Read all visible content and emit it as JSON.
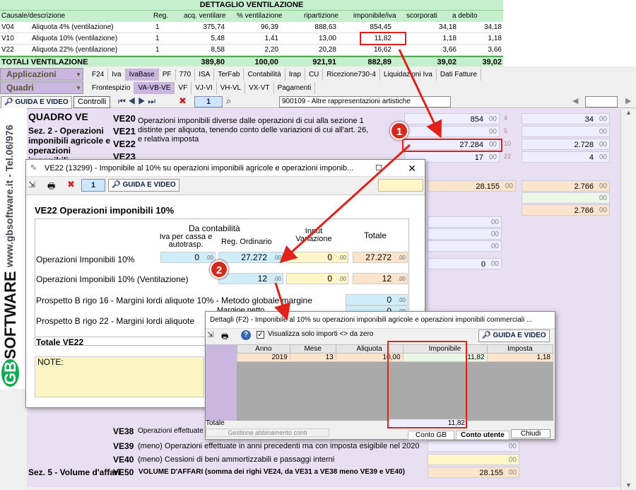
{
  "vent": {
    "title": "DETTAGLIO VENTILAZIONE",
    "headers": [
      "Causale/descrizione",
      "Reg.",
      "acq. ventilare",
      "% ventilazione",
      "ripartizione",
      "imponibile/iva",
      "scorporati",
      "a debito"
    ],
    "rows": [
      [
        "V04",
        "Aliquota 4% (ventilazione)",
        "1",
        "375,74",
        "96,39",
        "888,63",
        "854,45",
        "34,18",
        "34,18"
      ],
      [
        "V10",
        "Aliquota 10% (ventilazione)",
        "1",
        "5,48",
        "1,41",
        "13,00",
        "11,82",
        "1,18",
        "1,18"
      ],
      [
        "V22",
        "Aliquota 22% (ventilazione)",
        "1",
        "8,58",
        "2,20",
        "20,28",
        "16,62",
        "3,66",
        "3,66"
      ]
    ],
    "total": [
      "TOTALI VENTILAZIONE",
      "389,80",
      "100,00",
      "921,91",
      "882,89",
      "39,02",
      "39,02"
    ]
  },
  "nav": {
    "app_label": "Applicazioni",
    "quadri_label": "Quadri",
    "tabs1": [
      "F24",
      "Iva",
      "IvaBase",
      "PF",
      "770",
      "ISA",
      "TerFab",
      "Contabilità",
      "Irap",
      "CU",
      "Ricezione730-4",
      "Liquidazioni Iva",
      "Dati Fatture"
    ],
    "tabs2": [
      "Frontespizio",
      "VA-VB-VE",
      "VF",
      "VJ-VI",
      "VH-VL",
      "VX-VT",
      "Pagamenti"
    ]
  },
  "toolbar": {
    "guide": "GUIDA E VIDEO",
    "controlli": "Controlli",
    "page": "1",
    "select": "900109 - Altre rappresentazioni artistiche"
  },
  "side": {
    "phone": "Tel.06/976",
    "site": "www.gbsoftware.it -",
    "brand": "SOFTWARE",
    "logo": "GB"
  },
  "quadro": {
    "title": "QUADRO VE",
    "sez2": "Sez. 2 - Operazioni imponibili agricole e operazioni imponibili",
    "desc": "Operazioni imponibili diverse dalle operazioni di cui alla sezione 1 distinte per aliquota, tenendo conto delle variazioni di cui all'art. 26, e relativa imposta",
    "codes": [
      "VE20",
      "VE21",
      "VE22",
      "VE23"
    ],
    "vals": [
      "854",
      "",
      "27.284",
      "17"
    ],
    "rates": [
      "4",
      "5",
      "10",
      "22"
    ],
    "taxes": [
      "34",
      "",
      "2.728",
      "4"
    ],
    "v2": "28.155",
    "tax2": "2.766",
    "tax3": "2.766",
    "zero": "0",
    "cents": "00",
    "ve38": "VE38",
    "ve38_text": "Operazioni effettuate",
    "ve39": "VE39",
    "ve39_text": "(meno) Operazioni effettuate in anni precedenti ma con imposta esigibile nel 2020",
    "ve40": "VE40",
    "ve40_text": "(meno) Cessioni di beni ammortizzabili e passaggi interni",
    "sez5": "Sez. 5 - Volume d'affari",
    "ve50": "VE50",
    "ve50_text": "VOLUME D'AFFARI (somma dei righi VE24, da VE31 a VE38 meno VE39 e VE40)",
    "ve50_val": "28.155"
  },
  "dlg1": {
    "title": "VE22 (13299) - Imponibile al 10% su operazioni imponibili agricole e operazioni imponib...",
    "page": "1",
    "guide": "GUIDA E VIDEO",
    "heading": "VE22 Operazioni imponibili 10%",
    "da": "Da  contabilità",
    "col_cassa": "Iva per cassa e autotrasp.",
    "col_reg": "Reg. Ordinario",
    "col_input": "Input Variazione",
    "col_tot": "Totale",
    "r1": "Operazioni Imponibili 10%",
    "r1v": [
      "0",
      "27.272",
      "0",
      "27.272"
    ],
    "r2": "Operazioni Imponibili 10% (Ventilazione)",
    "r2v": [
      "12",
      "0",
      "12"
    ],
    "r3": "Prospetto B rigo 16 - Margini lordi aliquote 10% - Metodo globale margine",
    "r3v": "0",
    "r4": "Prospetto B rigo 22 - Margini lordi aliquote",
    "r4v": "0",
    "margine": "Margine netto",
    "totale": "Totale VE22",
    "note": "NOTE:",
    "cents": ".00"
  },
  "dlg2": {
    "title": "Dettagli (F2) - Imponibile al 10% su operazioni imponibili agricole e operazioni imponibili commerciali ...",
    "check": "Visualizza solo importi <> da zero",
    "guide": "GUIDA E VIDEO",
    "cols": [
      "Anno",
      "Mese",
      "Aliquota",
      "Imponibile",
      "Imposta"
    ],
    "row": [
      "2019",
      "13",
      "10,00",
      "11,82",
      "1,18"
    ],
    "tot_label": "Totale",
    "tot_val": "11,82",
    "gestione": "Gestione abbinamento conti",
    "conto_gb": "Conto GB",
    "conto_ut": "Conto utente",
    "chiudi": "Chiudi"
  },
  "badges": [
    "1",
    "2"
  ],
  "colors": {
    "accent_red": "#e0221b",
    "lilac": "#c9b7e0",
    "green": "#c6efce"
  }
}
